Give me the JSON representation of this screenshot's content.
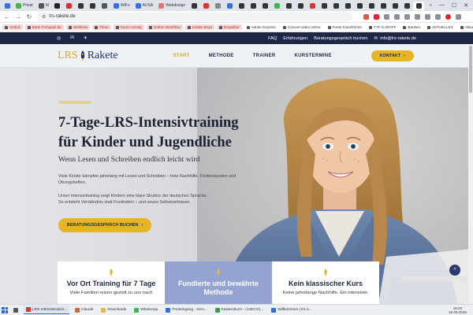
{
  "browser": {
    "tabs": [
      {
        "label": "",
        "color": "#3d6fd8"
      },
      {
        "label": "Privat",
        "color": "#4caf50"
      },
      {
        "label": "M",
        "color": "#555"
      },
      {
        "label": "",
        "color": "#222"
      },
      {
        "label": "",
        "color": "#c33"
      },
      {
        "label": "",
        "color": "#333"
      },
      {
        "label": "",
        "color": "#333"
      },
      {
        "label": "",
        "color": "#555"
      },
      {
        "label": "WiFo",
        "color": "#3d6fd8"
      },
      {
        "label": "AUSA",
        "color": "#3d6fd8"
      },
      {
        "label": "Webdesign",
        "color": "#e57373"
      },
      {
        "label": "",
        "color": "#333"
      },
      {
        "label": "",
        "color": "#d33"
      },
      {
        "label": "",
        "color": "#888"
      },
      {
        "label": "",
        "color": "#3d6fd8"
      },
      {
        "label": "",
        "color": "#333"
      },
      {
        "label": "",
        "color": "#333"
      },
      {
        "label": "",
        "color": "#333"
      },
      {
        "label": "",
        "color": "#4caf50"
      },
      {
        "label": "",
        "color": "#333"
      },
      {
        "label": "",
        "color": "#333"
      },
      {
        "label": "",
        "color": "#d33"
      },
      {
        "label": "",
        "color": "#333"
      },
      {
        "label": "",
        "color": "#333"
      },
      {
        "label": "",
        "color": "#333"
      },
      {
        "label": "",
        "color": "#333"
      },
      {
        "label": "",
        "color": "#333"
      },
      {
        "label": "",
        "color": "#333"
      },
      {
        "label": "",
        "color": "#333"
      },
      {
        "label": "",
        "color": "#333"
      },
      {
        "label": "",
        "color": "#333",
        "active": true
      }
    ],
    "new_tab": "+",
    "window_controls": {
      "minimize": "—",
      "maximize": "☐",
      "close": "✕"
    },
    "address": {
      "back": "←",
      "forward": "→",
      "reload": "↻",
      "url": "lrs-rakete.de"
    }
  },
  "bookmarks": [
    {
      "label": "Airdick",
      "hl": true
    },
    {
      "label": "Bank Frühgspil.de",
      "hl": true
    },
    {
      "label": "Wellness",
      "hl": true
    },
    {
      "label": "Filme",
      "hl": true
    },
    {
      "label": "Daniu Anzeig",
      "hl": true
    },
    {
      "label": "Gather Workflow",
      "hl": true
    },
    {
      "label": "Insider Buys",
      "hl": true
    },
    {
      "label": "Empathie",
      "hl": true
    },
    {
      "label": "Adobe Express",
      "hl": false
    },
    {
      "label": "Concert video online",
      "hl": false
    },
    {
      "label": "Fonts Transformer",
      "hl": false
    },
    {
      "label": "TTF to WOFF",
      "hl": false
    },
    {
      "label": "Banken",
      "hl": false
    },
    {
      "label": "AKTUELLES",
      "hl": false
    },
    {
      "label": "Aktuelle Kunden",
      "hl": false
    }
  ],
  "site": {
    "topbar": {
      "social": [
        "◎",
        "in",
        "✈"
      ],
      "links": [
        "FAQ",
        "Erfahrungen",
        "Beratungsgespräch buchen"
      ],
      "email": "info@lrs-rakete.de"
    },
    "logo": {
      "part1": "LRS",
      "part2": "Rakete"
    },
    "nav": [
      {
        "label": "START",
        "current": true
      },
      {
        "label": "METHODE",
        "current": false
      },
      {
        "label": "TRAINER",
        "current": false
      },
      {
        "label": "KURSTERMINE",
        "current": false
      }
    ],
    "kontakt": {
      "label": "KONTAKT",
      "arrow": "›"
    },
    "hero": {
      "title_line1": "7-Tage-LRS-Intensivtraining",
      "title_line2": "für Kinder und Jugendliche",
      "subtitle": "Wenn Lesen und Schreiben endlich leicht wird",
      "p1": "Viele Kinder kämpfen jahrelang mit Lesen und Schreiben – trotz Nachhilfe, Förderstunden und Übungsheften.",
      "p2_line1": "Unser Intensivtraining zeigt Kindern eine klare Struktur der deutschen Sprache.",
      "p2_line2": "So entsteht Verständnis statt Frustration – und neues Selbstvertrauen.",
      "cta": "BERATUNGSGESPRÄCH BUCHEN",
      "cta_arrow": "›"
    },
    "cards": [
      {
        "title": "Vor Ort Training für 7 Tage",
        "text": "Viele Familien reisen gezielt zu uns nach"
      },
      {
        "title": "Fundierte und bewährte Methode",
        "text": ""
      },
      {
        "title": "Kein klassischer Kurs",
        "text": "Keine jahrelange Nachhilfe. Ein intensiver,"
      }
    ],
    "scroll_top": "^"
  },
  "taskbar": {
    "items": [
      {
        "label": "",
        "color": "#555",
        "active": false
      },
      {
        "label": "LRS Intensivtrainin...",
        "color": "#d33",
        "active": true
      },
      {
        "label": "Claude",
        "color": "#c96a3c",
        "active": false
      },
      {
        "label": "Downloads",
        "color": "#e8b84a",
        "active": false
      },
      {
        "label": "WhatsApp",
        "color": "#3cb55b",
        "active": false
      },
      {
        "label": "Posteingang - zero...",
        "color": "#2f6fd8",
        "active": false
      },
      {
        "label": "Kassenbuch - (14ECO)...",
        "color": "#3a9a4b",
        "active": false
      },
      {
        "label": "Willkommen | lrs-3...",
        "color": "#2f6fd8",
        "active": false
      }
    ],
    "time": "15:02",
    "date": "16.09.2025"
  }
}
